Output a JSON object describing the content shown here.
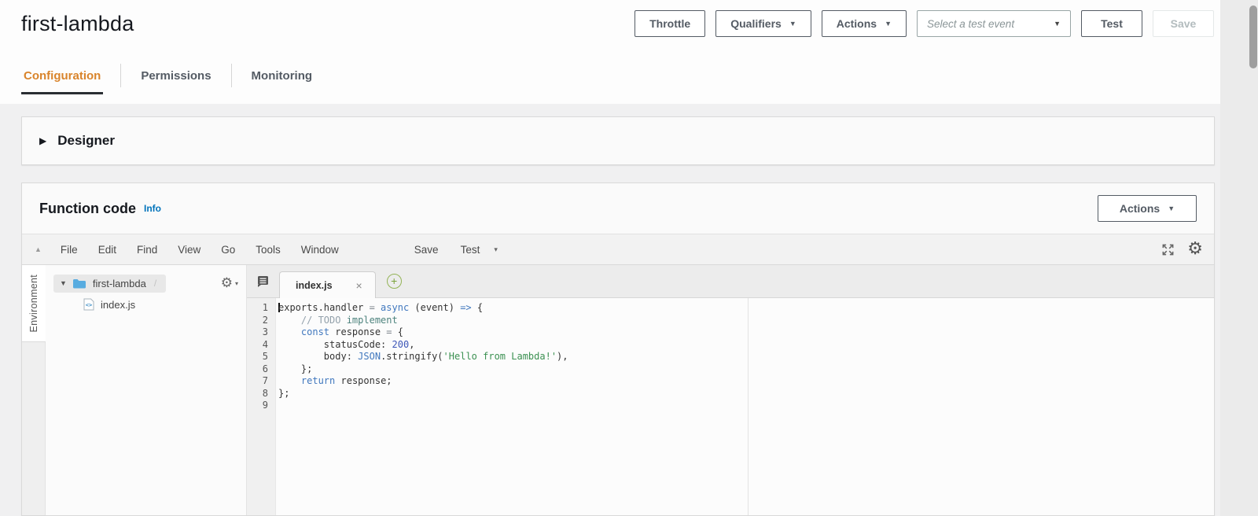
{
  "header": {
    "title": "first-lambda",
    "buttons": {
      "throttle": "Throttle",
      "qualifiers": "Qualifiers",
      "actions": "Actions",
      "test": "Test",
      "save": "Save"
    },
    "test_event_placeholder": "Select a test event"
  },
  "tabs": [
    {
      "label": "Configuration",
      "active": true
    },
    {
      "label": "Permissions",
      "active": false
    },
    {
      "label": "Monitoring",
      "active": false
    }
  ],
  "designer": {
    "title": "Designer"
  },
  "function_code": {
    "title": "Function code",
    "info": "Info",
    "actions_label": "Actions"
  },
  "editor": {
    "menus": [
      "File",
      "Edit",
      "Find",
      "View",
      "Go",
      "Tools",
      "Window"
    ],
    "menu_save": "Save",
    "menu_test": "Test",
    "env_tab": "Environment",
    "tree": {
      "folder": "first-lambda",
      "path_suffix": "/",
      "file": "index.js"
    },
    "open_tab": "index.js",
    "code_lines": [
      [
        {
          "t": "exports.handler ",
          "c": "plain"
        },
        {
          "t": "= ",
          "c": "op"
        },
        {
          "t": "async",
          "c": "kw"
        },
        {
          "t": " (event) ",
          "c": "plain"
        },
        {
          "t": "=>",
          "c": "kw"
        },
        {
          "t": " {",
          "c": "plain"
        }
      ],
      [
        {
          "t": "    ",
          "c": "plain"
        },
        {
          "t": "// TODO ",
          "c": "cmt"
        },
        {
          "t": "implement",
          "c": "cmtb"
        }
      ],
      [
        {
          "t": "    ",
          "c": "plain"
        },
        {
          "t": "const",
          "c": "kw"
        },
        {
          "t": " response ",
          "c": "plain"
        },
        {
          "t": "= ",
          "c": "op"
        },
        {
          "t": "{",
          "c": "plain"
        }
      ],
      [
        {
          "t": "        statusCode: ",
          "c": "plain"
        },
        {
          "t": "200",
          "c": "num"
        },
        {
          "t": ",",
          "c": "plain"
        }
      ],
      [
        {
          "t": "        body: ",
          "c": "plain"
        },
        {
          "t": "JSON",
          "c": "kw"
        },
        {
          "t": ".stringify(",
          "c": "plain"
        },
        {
          "t": "'Hello from Lambda!'",
          "c": "str"
        },
        {
          "t": "),",
          "c": "plain"
        }
      ],
      [
        {
          "t": "    };",
          "c": "plain"
        }
      ],
      [
        {
          "t": "    ",
          "c": "plain"
        },
        {
          "t": "return",
          "c": "kw"
        },
        {
          "t": " response;",
          "c": "plain"
        }
      ],
      [
        {
          "t": "};",
          "c": "plain"
        }
      ],
      []
    ]
  },
  "icons": {
    "caret_down": "▼",
    "caret_down_small": "▾",
    "caret_up": "▲",
    "arrow_right": "▶",
    "gear": "⚙",
    "close": "×",
    "plus": "+"
  },
  "colors": {
    "accent_orange": "#d9842b",
    "link_blue": "#0073bb",
    "tab_underline": "#2a2e33"
  }
}
